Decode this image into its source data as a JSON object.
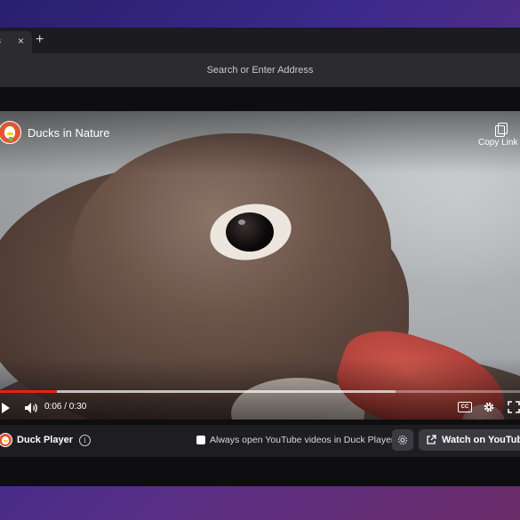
{
  "browser": {
    "tab": {
      "title": "s",
      "close_glyph": "×"
    },
    "new_tab_glyph": "+",
    "address_placeholder": "Search or Enter Address"
  },
  "video": {
    "channel_title": "Ducks in Nature",
    "copy_link_label": "Copy Link",
    "time": "0:06 / 0:30",
    "progress_fraction": 0.11,
    "buffered_fraction": 0.76,
    "cc_label": "CC"
  },
  "duck_player_bar": {
    "brand_label": "Duck Player",
    "info_glyph": "i",
    "always_open_label": "Always open YouTube videos in Duck Player",
    "always_open_checked": false,
    "watch_button_label": "Watch on YouTube"
  },
  "colors": {
    "progress": "#e62117",
    "brand": "#de5833",
    "background_gradient": [
      "#2a1f6e",
      "#6b2b68"
    ]
  },
  "icons": [
    "close-icon",
    "plus-icon",
    "duckduckgo-logo-icon",
    "copy-icon",
    "play-icon",
    "volume-icon",
    "cc-icon",
    "gear-icon",
    "fullscreen-icon",
    "info-icon",
    "external-link-icon"
  ]
}
